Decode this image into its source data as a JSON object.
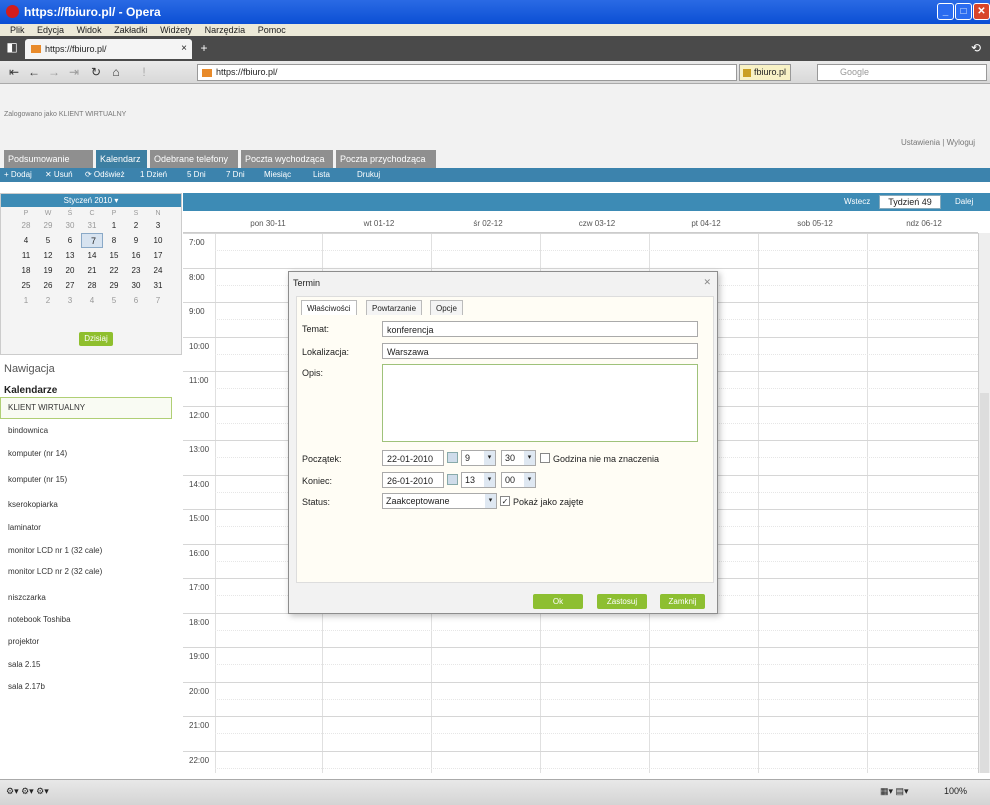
{
  "window": {
    "title": "https://fbiuro.pl/ - Opera"
  },
  "menu": [
    "Plik",
    "Edycja",
    "Widok",
    "Zakładki",
    "Widżety",
    "Narzędzia",
    "Pomoc"
  ],
  "tab": {
    "label": "https://fbiuro.pl/"
  },
  "address": {
    "url": "https://fbiuro.pl/",
    "site": "fbiuro.pl",
    "search_placeholder": "Google"
  },
  "page": {
    "logged_in": "Zalogowano jako KLIENT WIRTUALNY",
    "settings": "Ustawienia | Wyloguj"
  },
  "nav_tabs": [
    "Podsumowanie",
    "Kalendarz",
    "Odebrane telefony",
    "Poczta wychodząca",
    "Poczta przychodząca"
  ],
  "toolbar": {
    "add": "+ Dodaj",
    "del": "✕ Usuń",
    "refresh": "⟳ Odśwież",
    "day1": "1 Dzień",
    "day5": "5 Dni",
    "day7": "7 Dni",
    "month": "Miesiąc",
    "list": "Lista",
    "print": "Drukuj"
  },
  "mini_cal": {
    "title": "Styczeń 2010 ▾",
    "weekdays": [
      "P",
      "W",
      "Ś",
      "C",
      "P",
      "S",
      "N"
    ],
    "rows": [
      [
        "28",
        "29",
        "30",
        "31",
        "1",
        "2",
        "3"
      ],
      [
        "4",
        "5",
        "6",
        "7",
        "8",
        "9",
        "10"
      ],
      [
        "11",
        "12",
        "13",
        "14",
        "15",
        "16",
        "17"
      ],
      [
        "18",
        "19",
        "20",
        "21",
        "22",
        "23",
        "24"
      ],
      [
        "25",
        "26",
        "27",
        "28",
        "29",
        "30",
        "31"
      ],
      [
        "1",
        "2",
        "3",
        "4",
        "5",
        "6",
        "7"
      ]
    ],
    "today_btn": "Dzisiaj"
  },
  "sidebar": {
    "nav_label": "Nawigacja",
    "calendars_label": "Kalendarze",
    "items": [
      "KLIENT WIRTUALNY",
      "bindownica",
      "komputer (nr 14)",
      "komputer (nr 15)",
      "kserokopiarka",
      "laminator",
      "monitor LCD nr 1 (32 cale)",
      "monitor LCD nr 2 (32 cale)",
      "niszczarka",
      "notebook Toshiba",
      "projektor",
      "sala 2.15",
      "sala 2.17b"
    ]
  },
  "calendar": {
    "prev": "Wstecz",
    "week": "Tydzień 49",
    "next": "Dalej",
    "days": [
      "pon 30-11",
      "wt 01-12",
      "śr 02-12",
      "czw 03-12",
      "pt 04-12",
      "sob 05-12",
      "ndz 06-12"
    ],
    "hours": [
      "7:00",
      "8:00",
      "9:00",
      "10:00",
      "11:00",
      "12:00",
      "13:00",
      "14:00",
      "15:00",
      "16:00",
      "17:00",
      "18:00",
      "19:00",
      "20:00",
      "21:00",
      "22:00"
    ]
  },
  "dialog": {
    "title": "Termin",
    "tabs": [
      "Właściwości",
      "Powtarzanie",
      "Opcje"
    ],
    "temat_label": "Temat:",
    "temat": "konferencja",
    "lok_label": "Lokalizacja:",
    "lok": "Warszawa",
    "opis_label": "Opis:",
    "start_label": "Początek:",
    "start_date": "22-01-2010",
    "start_h": "9",
    "start_m": "30",
    "allday": "Godzina nie ma znaczenia",
    "end_label": "Koniec:",
    "end_date": "26-01-2010",
    "end_h": "13",
    "end_m": "00",
    "status_label": "Status:",
    "status": "Zaakceptowane",
    "busy": "Pokaż jako zajęte",
    "ok": "Ok",
    "apply": "Zastosuj",
    "close": "Zamknij"
  },
  "status": {
    "zoom": "100%"
  }
}
